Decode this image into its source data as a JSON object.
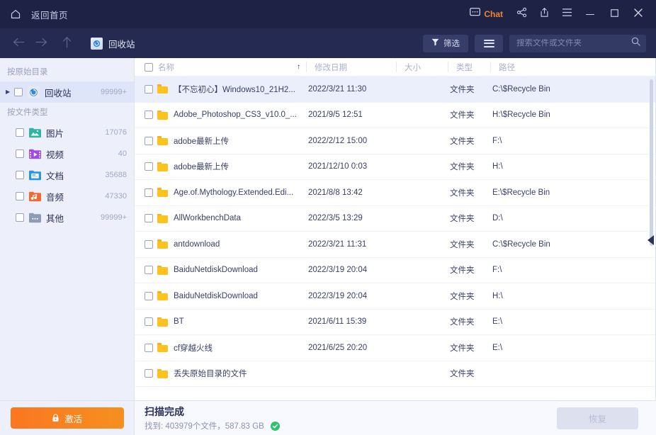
{
  "titlebar": {
    "home_label": "返回首页",
    "chat_label": "Chat",
    "minimize": "—",
    "maximize": "▢",
    "close": "✕"
  },
  "navbar": {
    "breadcrumb": "回收站",
    "filter_label": "筛选",
    "search_placeholder": "搜索文件或文件夹",
    "search_value": ""
  },
  "sidebar": {
    "group1_title": "按原始目录",
    "group2_title": "按文件类型",
    "tree_items": [
      {
        "label": "回收站",
        "count": "99999+",
        "icon": "recycle-bin-icon",
        "selected": true
      }
    ],
    "type_items": [
      {
        "label": "图片",
        "count": "17076",
        "icon": "image-folder-icon",
        "color": "#2eb6a0"
      },
      {
        "label": "视频",
        "count": "40",
        "icon": "video-folder-icon",
        "color": "#a04ce0"
      },
      {
        "label": "文档",
        "count": "35688",
        "icon": "document-folder-icon",
        "color": "#2b95e0"
      },
      {
        "label": "音频",
        "count": "47330",
        "icon": "audio-folder-icon",
        "color": "#f06a32"
      },
      {
        "label": "其他",
        "count": "99999+",
        "icon": "other-folder-icon",
        "color": "#8e9bb5"
      }
    ]
  },
  "filelist": {
    "columns": {
      "name": "名称",
      "date": "修改日期",
      "size": "大小",
      "type": "类型",
      "path": "路径"
    },
    "sort_indicator": "↑",
    "rows": [
      {
        "name": "【不忘初心】Windows10_21H2...",
        "date": "2022/3/21 11:30",
        "size": "",
        "type": "文件夹",
        "path": "C:\\$Recycle Bin",
        "selected": true
      },
      {
        "name": "Adobe_Photoshop_CS3_v10.0_...",
        "date": "2021/9/5 12:51",
        "size": "",
        "type": "文件夹",
        "path": "H:\\$Recycle Bin",
        "selected": false
      },
      {
        "name": "adobe最新上传",
        "date": "2022/2/12 15:00",
        "size": "",
        "type": "文件夹",
        "path": "F:\\",
        "selected": false
      },
      {
        "name": "adobe最新上传",
        "date": "2021/12/10 0:03",
        "size": "",
        "type": "文件夹",
        "path": "H:\\",
        "selected": false
      },
      {
        "name": "Age.of.Mythology.Extended.Edi...",
        "date": "2021/8/8 13:42",
        "size": "",
        "type": "文件夹",
        "path": "E:\\$Recycle Bin",
        "selected": false
      },
      {
        "name": "AllWorkbenchData",
        "date": "2022/3/5 13:29",
        "size": "",
        "type": "文件夹",
        "path": "D:\\",
        "selected": false
      },
      {
        "name": "antdownload",
        "date": "2022/3/21 11:31",
        "size": "",
        "type": "文件夹",
        "path": "C:\\$Recycle Bin",
        "selected": false
      },
      {
        "name": "BaiduNetdiskDownload",
        "date": "2022/3/19 20:04",
        "size": "",
        "type": "文件夹",
        "path": "F:\\",
        "selected": false
      },
      {
        "name": "BaiduNetdiskDownload",
        "date": "2022/3/19 20:04",
        "size": "",
        "type": "文件夹",
        "path": "H:\\",
        "selected": false
      },
      {
        "name": "BT",
        "date": "2021/6/11 15:39",
        "size": "",
        "type": "文件夹",
        "path": "E:\\",
        "selected": false
      },
      {
        "name": "cf穿越火线",
        "date": "2021/6/25 20:20",
        "size": "",
        "type": "文件夹",
        "path": "E:\\",
        "selected": false
      },
      {
        "name": "丢失原始目录的文件",
        "date": "",
        "size": "",
        "type": "文件夹",
        "path": "",
        "selected": false
      }
    ]
  },
  "bottom": {
    "activate_label": "激活",
    "scan_title": "扫描完成",
    "scan_sub": "找到: 403979个文件，587.83 GB",
    "recover_label": "恢复"
  },
  "colors": {
    "titlebar": "#1e2346",
    "navbar": "#242a52",
    "accent_orange": "#f0832c",
    "sidebar_bg": "#edf0fa",
    "selected_row": "#eaeffb",
    "success_green": "#2ec26b",
    "folder_yellow": "#fcc21d"
  }
}
